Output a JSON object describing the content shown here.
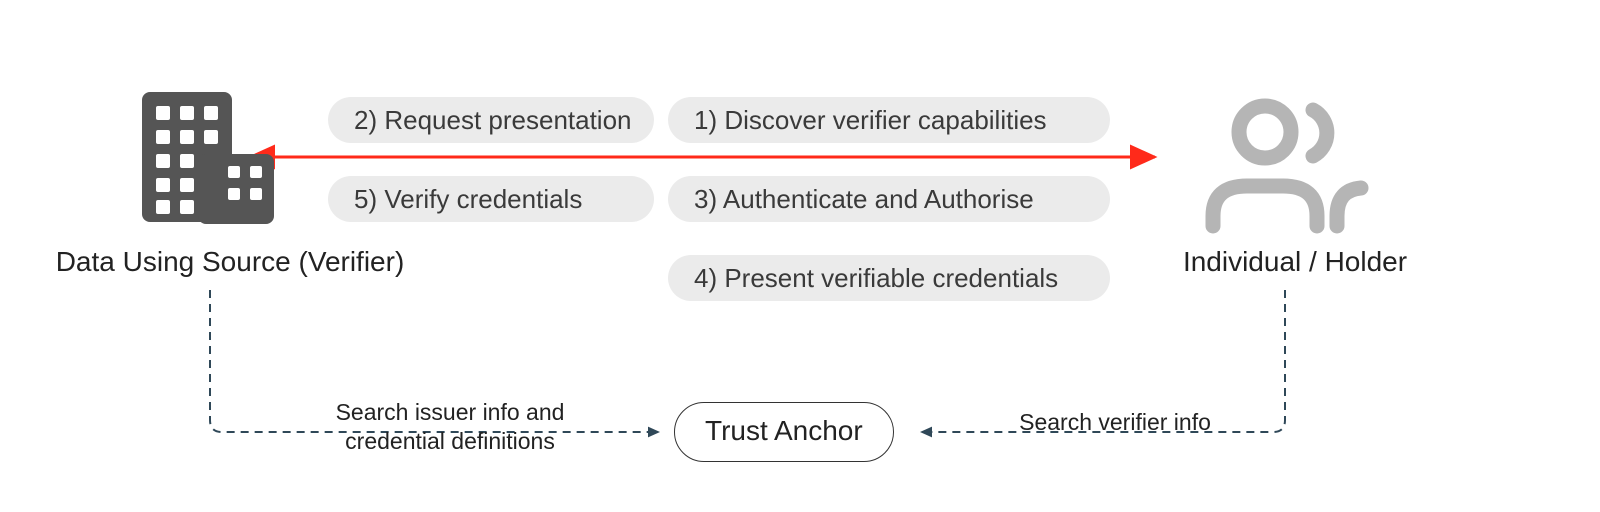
{
  "actors": {
    "verifier_label": "Data Using Source (Verifier)",
    "holder_label": "Individual / Holder"
  },
  "steps": {
    "s1": "1) Discover verifier capabilities",
    "s2": "2) Request presentation",
    "s3": "3) Authenticate and Authorise",
    "s4": "4) Present verifiable credentials",
    "s5": "5) Verify credentials"
  },
  "trust_anchor": {
    "label": "Trust Anchor"
  },
  "edges": {
    "left_label_line1": "Search issuer info and",
    "left_label_line2": "credential definitions",
    "right_label": "Search verifier info"
  },
  "colors": {
    "red_arrow": "#ff2a1a",
    "icon_grey": "#b5b5b5",
    "building_grey": "#555555"
  }
}
